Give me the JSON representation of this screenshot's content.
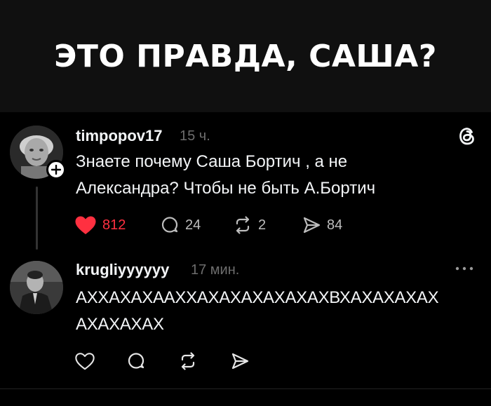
{
  "headline": {
    "text": "ЭТО ПРАВДА, САША?"
  },
  "posts": [
    {
      "username": "timpopov17",
      "time": "15 ч.",
      "text_lines": [
        "Знаете почему Саша Бортич , а не",
        "Александра? Чтобы не быть А.Бортич"
      ],
      "likes": "812",
      "comments": "24",
      "reposts": "2",
      "shares": "84"
    },
    {
      "username": "kruglіyyyyyy",
      "time": "17 мин.",
      "text_lines": [
        "АХХАХАХААХХАХАХАХАХАХАХВХАХАХАХАХ",
        "АХАХАХАХ"
      ]
    }
  ],
  "colors": {
    "like_active": "#ff3040",
    "muted": "#6d6d6d",
    "text": "#f3f5f7",
    "background": "#000000"
  },
  "icons": [
    "threads-logo-icon",
    "heart-icon",
    "comment-icon",
    "repost-icon",
    "share-icon",
    "more-options-icon",
    "follow-plus-icon"
  ]
}
